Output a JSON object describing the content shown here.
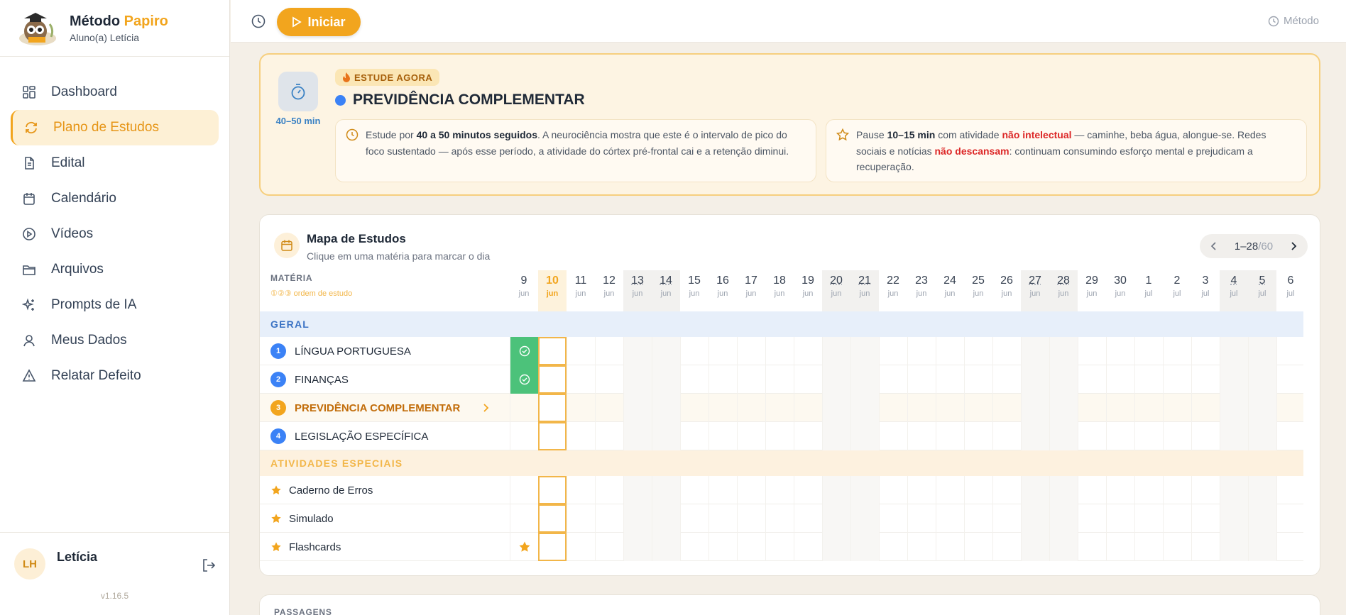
{
  "brand": {
    "title_part1": "Método",
    "title_part2": "Papiro",
    "subtitle": "Aluno(a) Letícia"
  },
  "nav": [
    {
      "label": "Dashboard",
      "icon": "dashboard-icon",
      "active": false
    },
    {
      "label": "Plano de Estudos",
      "icon": "refresh-icon",
      "active": true
    },
    {
      "label": "Edital",
      "icon": "document-icon",
      "active": false
    },
    {
      "label": "Calendário",
      "icon": "calendar-icon",
      "active": false
    },
    {
      "label": "Vídeos",
      "icon": "play-circle-icon",
      "active": false
    },
    {
      "label": "Arquivos",
      "icon": "folder-icon",
      "active": false
    },
    {
      "label": "Prompts de IA",
      "icon": "sparkles-icon",
      "active": false
    },
    {
      "label": "Meus Dados",
      "icon": "user-icon",
      "active": false
    },
    {
      "label": "Relatar Defeito",
      "icon": "warning-icon",
      "active": false
    }
  ],
  "user": {
    "initials": "LH",
    "name": "Letícia",
    "version": "v1.16.5"
  },
  "topbar": {
    "start_label": "Iniciar",
    "method_label": "Método"
  },
  "focus": {
    "badge": "ESTUDE AGORA",
    "subject": "PREVIDÊNCIA COMPLEMENTAR",
    "duration": "40–50 min",
    "tip1": {
      "pre": "Estude por ",
      "bold": "40 a 50 minutos seguidos",
      "post": ". A neurociência mostra que este é o intervalo de pico do foco sustentado — após esse período, a atividade do córtex pré-frontal cai e a retenção diminui."
    },
    "tip2": {
      "pre": "Pause ",
      "bold": "10–15 min",
      "mid1": " com atividade ",
      "red1": "não intelectual",
      "mid2": " — caminhe, beba água, alongue-se. Redes sociais e notícias ",
      "red2": "não descansam",
      "post": ": continuam consumindo esforço mental e prejudicam a recuperação."
    }
  },
  "map": {
    "title": "Mapa de Estudos",
    "subtitle": "Clique em uma matéria para marcar o dia",
    "pager": {
      "range": "1–28",
      "total": "/60"
    },
    "column_label": "MATÉRIA",
    "order_hint": "①②③ ordem de estudo",
    "days": [
      {
        "num": "9",
        "mon": "jun"
      },
      {
        "num": "10",
        "mon": "jun"
      },
      {
        "num": "11",
        "mon": "jun"
      },
      {
        "num": "12",
        "mon": "jun"
      },
      {
        "num": "13",
        "mon": "jun"
      },
      {
        "num": "14",
        "mon": "jun"
      },
      {
        "num": "15",
        "mon": "jun"
      },
      {
        "num": "16",
        "mon": "jun"
      },
      {
        "num": "17",
        "mon": "jun"
      },
      {
        "num": "18",
        "mon": "jun"
      },
      {
        "num": "19",
        "mon": "jun"
      },
      {
        "num": "20",
        "mon": "jun"
      },
      {
        "num": "21",
        "mon": "jun"
      },
      {
        "num": "22",
        "mon": "jun"
      },
      {
        "num": "23",
        "mon": "jun"
      },
      {
        "num": "24",
        "mon": "jun"
      },
      {
        "num": "25",
        "mon": "jun"
      },
      {
        "num": "26",
        "mon": "jun"
      },
      {
        "num": "27",
        "mon": "jun"
      },
      {
        "num": "28",
        "mon": "jun"
      },
      {
        "num": "29",
        "mon": "jun"
      },
      {
        "num": "30",
        "mon": "jun"
      },
      {
        "num": "1",
        "mon": "jul"
      },
      {
        "num": "2",
        "mon": "jul"
      },
      {
        "num": "3",
        "mon": "jul"
      },
      {
        "num": "4",
        "mon": "jul"
      },
      {
        "num": "5",
        "mon": "jul"
      },
      {
        "num": "6",
        "mon": "jul"
      }
    ],
    "weekend_indices": [
      4,
      5,
      11,
      12,
      18,
      19,
      25,
      26
    ],
    "today_index": 1,
    "groups": {
      "geral": "GERAL",
      "especiais": "ATIVIDADES ESPECIAIS"
    },
    "subjects": [
      {
        "order": "1",
        "name": "LÍNGUA PORTUGUESA",
        "done": [
          0
        ]
      },
      {
        "order": "2",
        "name": "FINANÇAS",
        "done": [
          0
        ]
      },
      {
        "order": "3",
        "name": "PREVIDÊNCIA COMPLEMENTAR",
        "done": [],
        "current": true
      },
      {
        "order": "4",
        "name": "LEGISLAÇÃO ESPECÍFICA",
        "done": []
      }
    ],
    "specials": [
      {
        "name": "Caderno de Erros",
        "starred": []
      },
      {
        "name": "Simulado",
        "starred": []
      },
      {
        "name": "Flashcards",
        "starred": [
          0
        ]
      }
    ]
  },
  "passagens": {
    "label": "PASSAGENS"
  },
  "colors": {
    "accent": "#f2a51e",
    "blue": "#3b82f6",
    "green": "#4cc27a",
    "red": "#dc2626"
  }
}
